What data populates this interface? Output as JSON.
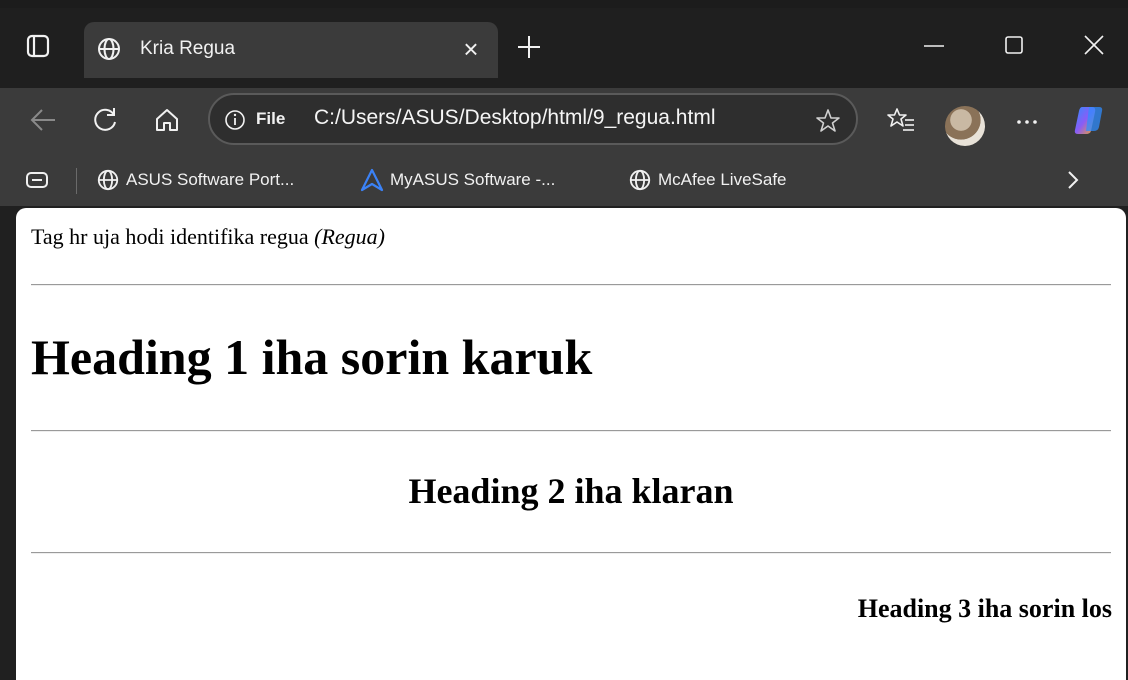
{
  "browser": {
    "tab": {
      "title": "Kria Regua",
      "close_glyph": "×"
    },
    "address": {
      "scheme_label": "File",
      "url": "C:/Users/ASUS/Desktop/html/9_regua.html"
    },
    "bookmarks": [
      {
        "label": "ASUS Software Port...",
        "icon": "globe-icon"
      },
      {
        "label": "MyASUS Software -...",
        "icon": "myasus-logo-icon"
      },
      {
        "label": "McAfee LiveSafe",
        "icon": "globe-icon"
      }
    ],
    "colors": {
      "chrome": "#3b3b3b",
      "titlebar": "#1f1f1f",
      "page": "#ffffff"
    }
  },
  "page": {
    "intro_text": "Tag hr uja hodi identifika regua ",
    "intro_emphasis": "(Regua)",
    "heading1": "Heading 1 iha sorin karuk",
    "heading2": "Heading 2 iha klaran",
    "heading3": "Heading 3 iha sorin los"
  }
}
